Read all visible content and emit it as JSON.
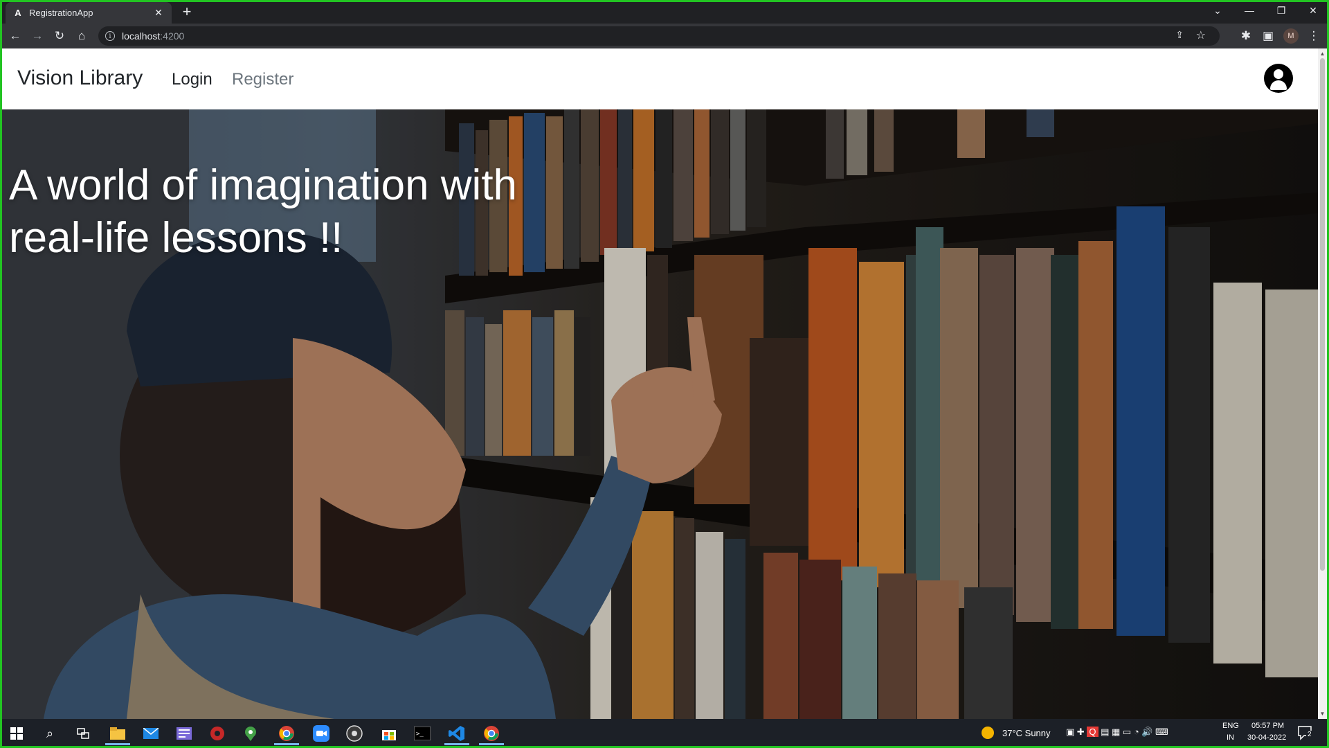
{
  "browser": {
    "tab_title": "RegistrationApp",
    "tab_favicon": "A",
    "new_tab_symbol": "+",
    "url_host": "localhost",
    "url_port": ":4200",
    "profile_initial": "M"
  },
  "navbar": {
    "brand": "Vision Library",
    "login": "Login",
    "register": "Register"
  },
  "hero": {
    "title_line1": "A world of imagination with",
    "title_line2": "real-life lessons !!"
  },
  "taskbar": {
    "weather": "37°C  Sunny",
    "lang_line1": "ENG",
    "lang_line2": "IN",
    "time": "05:57 PM",
    "date": "30-04-2022",
    "notifications": "2"
  },
  "colors": {
    "frame": "#22c422",
    "chrome_dark": "#202124",
    "chrome_toolbar": "#35363a",
    "taskbar": "#1c2027",
    "nav_muted": "#6c757d"
  }
}
